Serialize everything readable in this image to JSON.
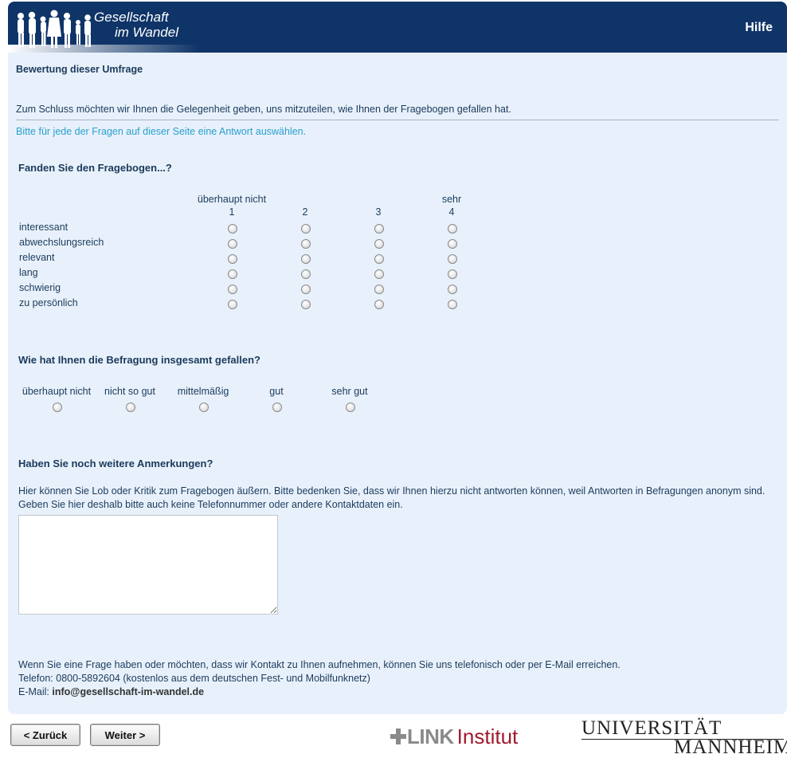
{
  "header": {
    "logo_line1": "Gesellschaft",
    "logo_line2": "im Wandel",
    "help_label": "Hilfe",
    "bg_color": "#0f3468"
  },
  "page": {
    "section_title": "Bewertung dieser Umfrage",
    "intro": "Zum Schluss möchten wir Ihnen die Gelegenheit geben, uns mitzuteilen, wie Ihnen der Fragebogen gefallen hat.",
    "hint": "Bitte für jede der Fragen auf dieser Seite eine Antwort auswählen."
  },
  "q1": {
    "title": "Fanden Sie den Fragebogen...?",
    "scale_low_label": "überhaupt nicht",
    "scale_high_label": "sehr",
    "scale_numbers": [
      "1",
      "2",
      "3",
      "4"
    ],
    "rows": [
      "interessant",
      "abwechslungsreich",
      "relevant",
      "lang",
      "schwierig",
      "zu persönlich"
    ]
  },
  "q2": {
    "title": "Wie hat Ihnen die Befragung insgesamt gefallen?",
    "options": [
      "überhaupt nicht",
      "nicht so gut",
      "mittelmäßig",
      "gut",
      "sehr gut"
    ]
  },
  "q3": {
    "title": "Haben Sie noch weitere Anmerkungen?",
    "text": "Hier können Sie Lob oder Kritik zum Fragebogen äußern. Bitte bedenken Sie, dass wir Ihnen hierzu nicht antworten können, weil Antworten in Befragungen anonym sind. Geben Sie hier deshalb bitte auch keine Telefonnummer oder andere Kontaktdaten ein.",
    "textarea_value": ""
  },
  "contact": {
    "line1": "Wenn Sie eine Frage haben oder möchten, dass wir Kontakt zu Ihnen aufnehmen, können Sie uns telefonisch oder per E-Mail erreichen.",
    "line2": "Telefon: 0800-5892604 (kostenlos aus dem deutschen Fest- und Mobilfunknetz)",
    "email_prefix": "E-Mail:",
    "email": "info@gesellschaft-im-wandel.de"
  },
  "nav": {
    "back_label": "< Zurück",
    "next_label": "Weiter >"
  },
  "footer": {
    "link_word": "LINK",
    "institut_word": "Institut",
    "uni_line1": "UNIVERSITÄT",
    "uni_line2": "MANNHEIM"
  }
}
